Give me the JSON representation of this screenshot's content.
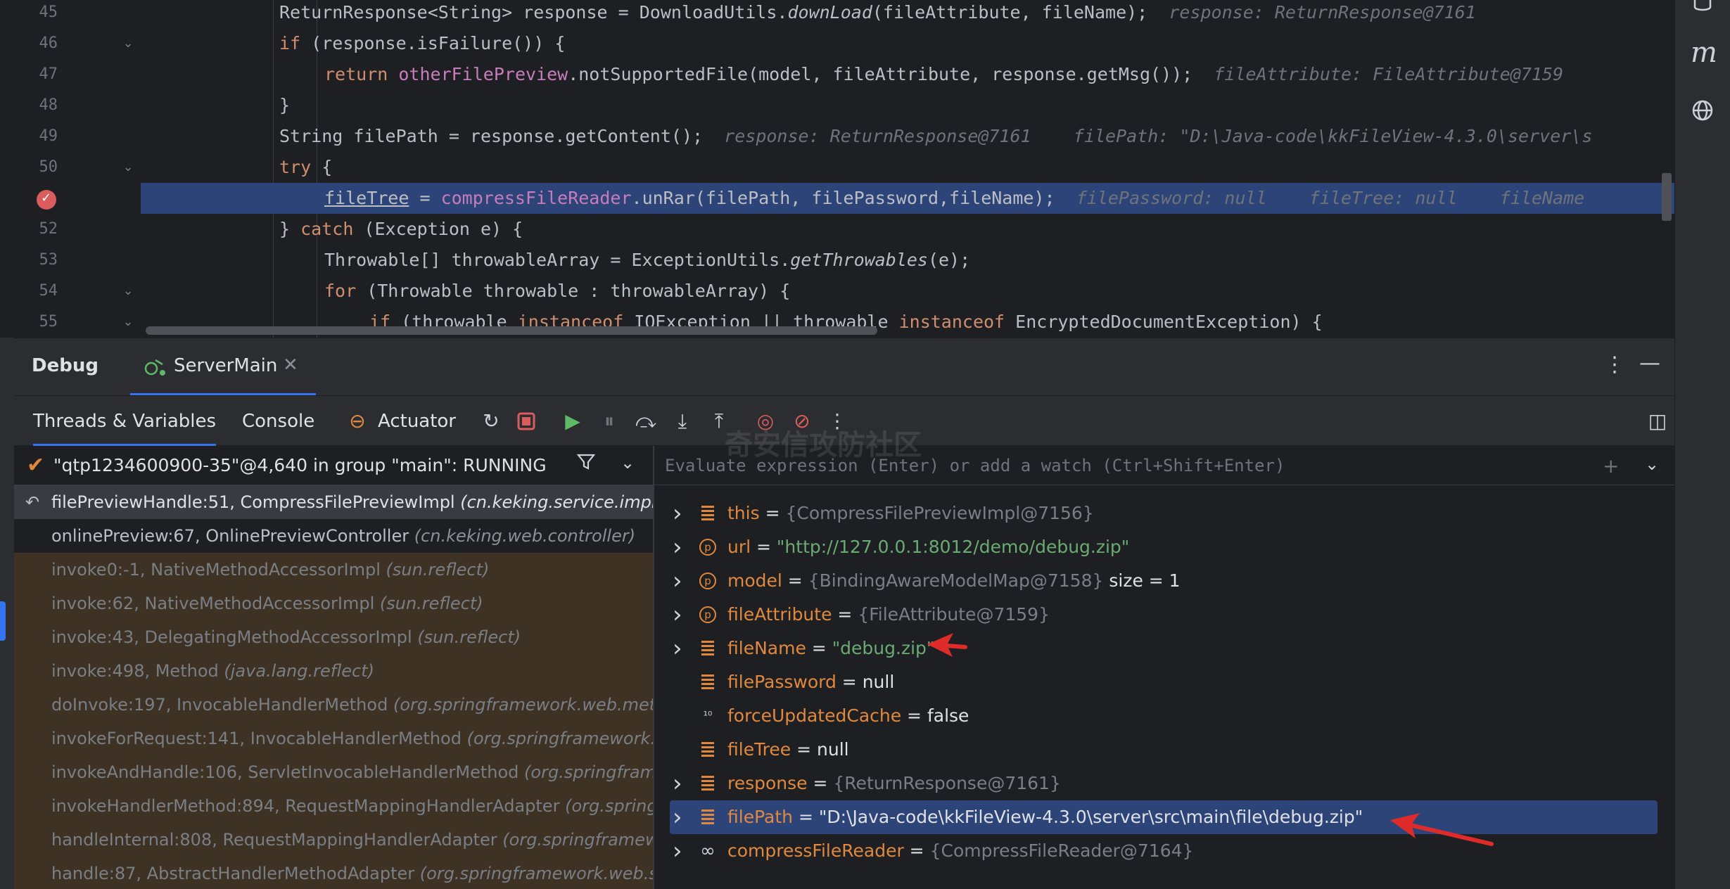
{
  "editor": {
    "lines": [
      {
        "num": "45"
      },
      {
        "num": "46"
      },
      {
        "num": "47"
      },
      {
        "num": "48"
      },
      {
        "num": "49"
      },
      {
        "num": "50"
      },
      {
        "num": "51"
      },
      {
        "num": "52"
      },
      {
        "num": "53"
      },
      {
        "num": "54"
      },
      {
        "num": "55"
      }
    ],
    "code": {
      "l45_a": "ReturnResponse<String> response = DownloadUtils.",
      "l45_fn": "downLoad",
      "l45_b": "(fileAttribute, fileName);",
      "l45_hint": "response: ReturnResponse@7161",
      "l46_kw": "if",
      "l46_b": " (response.isFailure()) {",
      "l47_kw": "return",
      "l47_fld": "otherFilePreview",
      "l47_b": ".notSupportedFile(model, fileAttribute, response.getMsg());",
      "l47_hint": "fileAttribute: FileAttribute@7159",
      "l48": "}",
      "l49_a": "String filePath = response.getContent();",
      "l49_hint1": "response: ReturnResponse@7161",
      "l49_hint2": "filePath: \"D:\\Java-code\\kkFileView-4.3.0\\server\\s",
      "l50_kw": "try",
      "l50_b": " {",
      "l51_var": "fileTree",
      "l51_eq": " = ",
      "l51_fld": "compressFileReader",
      "l51_b": ".unRar(filePath, filePassword,fileName);",
      "l51_hint1": "filePassword: null",
      "l51_hint2": "fileTree: null",
      "l51_hint3": "fileName",
      "l52_a": "} ",
      "l52_kw": "catch",
      "l52_b": " (Exception e) {",
      "l53_a": "Throwable[] throwableArray = ExceptionUtils.",
      "l53_fn": "getThrowables",
      "l53_b": "(e);",
      "l54_kw": "for",
      "l54_b": " (Throwable throwable : throwableArray) {",
      "l55_kw": "if",
      "l55_a": " (throwable ",
      "l55_kw2": "instanceof",
      "l55_b": " IOException || throwable ",
      "l55_kw3": "instanceof",
      "l55_c": " EncryptedDocumentException) {"
    }
  },
  "right_strip": {
    "icons": [
      "database-icon",
      "maven-icon",
      "web-icon"
    ],
    "maven_glyph": "m"
  },
  "debug": {
    "title": "Debug",
    "run_tab": "ServerMain",
    "close_glyph": "✕",
    "more_glyph": "⋮",
    "minimize_glyph": "—"
  },
  "toolbar": {
    "tabs": [
      "Threads & Variables",
      "Console",
      "Actuator"
    ],
    "layout_glyph": "◫"
  },
  "thread": {
    "label": "\"qtp1234600900-35\"@4,640 in group \"main\": RUNNING"
  },
  "frames": [
    {
      "method": "filePreviewHandle:51, CompressFilePreviewImpl ",
      "pkg": "(cn.keking.service.impl)",
      "kind": "current"
    },
    {
      "method": "onlinePreview:67, OnlinePreviewController ",
      "pkg": "(cn.keking.web.controller)",
      "kind": "normal"
    },
    {
      "method": "invoke0:-1, NativeMethodAccessorImpl ",
      "pkg": "(sun.reflect)",
      "kind": "lib"
    },
    {
      "method": "invoke:62, NativeMethodAccessorImpl ",
      "pkg": "(sun.reflect)",
      "kind": "lib"
    },
    {
      "method": "invoke:43, DelegatingMethodAccessorImpl ",
      "pkg": "(sun.reflect)",
      "kind": "lib"
    },
    {
      "method": "invoke:498, Method ",
      "pkg": "(java.lang.reflect)",
      "kind": "lib"
    },
    {
      "method": "doInvoke:197, InvocableHandlerMethod ",
      "pkg": "(org.springframework.web.method.support)",
      "kind": "lib"
    },
    {
      "method": "invokeForRequest:141, InvocableHandlerMethod ",
      "pkg": "(org.springframework.web.method.support)",
      "kind": "lib"
    },
    {
      "method": "invokeAndHandle:106, ServletInvocableHandlerMethod ",
      "pkg": "(org.springframework.web.servlet)",
      "kind": "lib"
    },
    {
      "method": "invokeHandlerMethod:894, RequestMappingHandlerAdapter ",
      "pkg": "(org.springframework.web.servlet)",
      "kind": "lib"
    },
    {
      "method": "handleInternal:808, RequestMappingHandlerAdapter ",
      "pkg": "(org.springframework.web.servlet)",
      "kind": "lib"
    },
    {
      "method": "handle:87, AbstractHandlerMethodAdapter ",
      "pkg": "(org.springframework.web.servlet)",
      "kind": "lib"
    }
  ],
  "evaluate": {
    "placeholder": "Evaluate expression (Enter) or add a watch (Ctrl+Shift+Enter)"
  },
  "variables": [
    {
      "name": "this",
      "value": "{CompressFilePreviewImpl@7156}",
      "vtype": "obj",
      "icon": "field",
      "expandable": true,
      "extra": ""
    },
    {
      "name": "url",
      "value": "\"http://127.0.0.1:8012/demo/debug.zip\"",
      "vtype": "str",
      "icon": "param",
      "expandable": true,
      "extra": ""
    },
    {
      "name": "model",
      "value": "{BindingAwareModelMap@7158}",
      "vtype": "obj",
      "icon": "param",
      "expandable": true,
      "extra": " size = 1"
    },
    {
      "name": "fileAttribute",
      "value": "{FileAttribute@7159}",
      "vtype": "obj",
      "icon": "param",
      "expandable": true,
      "extra": ""
    },
    {
      "name": "fileName",
      "value": "\"debug.zip\"",
      "vtype": "str",
      "icon": "field",
      "expandable": true,
      "extra": ""
    },
    {
      "name": "filePassword",
      "value": "null",
      "vtype": "plain",
      "icon": "field",
      "expandable": false,
      "extra": ""
    },
    {
      "name": "forceUpdatedCache",
      "value": "false",
      "vtype": "plain",
      "icon": "primitive",
      "expandable": false,
      "extra": ""
    },
    {
      "name": "fileTree",
      "value": "null",
      "vtype": "plain",
      "icon": "field",
      "expandable": false,
      "extra": ""
    },
    {
      "name": "response",
      "value": "{ReturnResponse@7161}",
      "vtype": "obj",
      "icon": "field",
      "expandable": true,
      "extra": ""
    },
    {
      "name": "filePath",
      "value": "\"D:\\Java-code\\kkFileView-4.3.0\\server\\src\\main\\file\\debug.zip\"",
      "vtype": "plain",
      "icon": "field",
      "expandable": true,
      "extra": "",
      "selected": true
    },
    {
      "name": "compressFileReader",
      "value": "{CompressFileReader@7164}",
      "vtype": "obj",
      "icon": "watch",
      "expandable": true,
      "extra": ""
    }
  ],
  "watermark": "奇安信攻防社区",
  "colors": {
    "accent": "#3574f0",
    "execution_line": "#2d4479",
    "annotation_arrow": "#e02b2b"
  }
}
